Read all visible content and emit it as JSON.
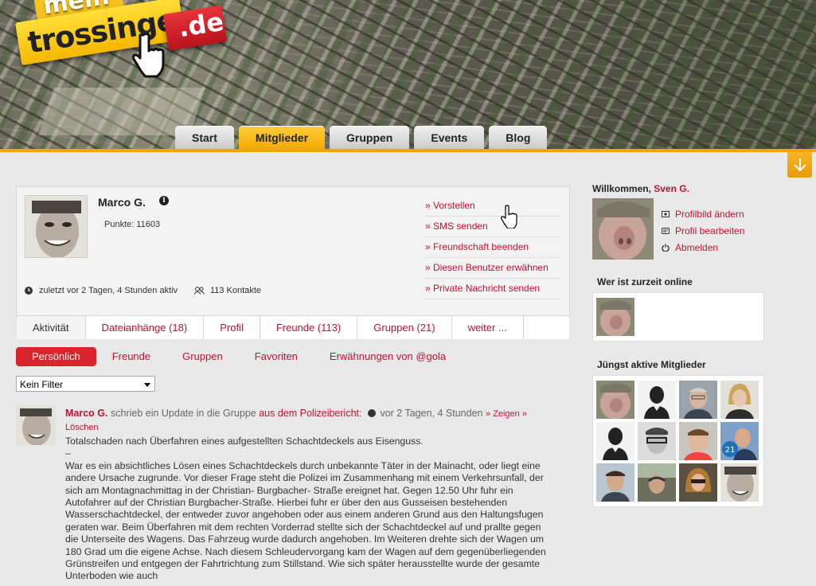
{
  "logo": {
    "line1": "mein",
    "line2": "trossingen",
    "tld": ".de"
  },
  "nav": {
    "tabs": [
      {
        "label": "Start",
        "active": false
      },
      {
        "label": "Mitglieder",
        "active": true
      },
      {
        "label": "Gruppen",
        "active": false
      },
      {
        "label": "Events",
        "active": false
      },
      {
        "label": "Blog",
        "active": false
      }
    ]
  },
  "profile": {
    "name": "Marco G.",
    "points": "Punkte: 11603",
    "last_active": "zuletzt vor 2 Tagen, 4 Stunden aktiv",
    "contacts": "113 Kontakte",
    "actions": [
      "» Vorstellen",
      "» SMS senden",
      "» Freundschaft beenden",
      "» Diesen Benutzer erwähnen",
      "» Private Nachricht senden"
    ],
    "tabs": [
      {
        "label": "Aktivität",
        "active": true
      },
      {
        "label": "Dateianhänge (18)",
        "active": false
      },
      {
        "label": "Profil",
        "active": false
      },
      {
        "label": "Freunde (113)",
        "active": false
      },
      {
        "label": "Gruppen (21)",
        "active": false
      },
      {
        "label": "weiter ...",
        "active": false
      }
    ]
  },
  "subnav": [
    {
      "label": "Persönlich",
      "active": true
    },
    {
      "label": "Freunde",
      "active": false
    },
    {
      "label": "Gruppen",
      "active": false
    },
    {
      "label": "Favoriten",
      "active": false
    },
    {
      "label": "Erwähnungen von @gola",
      "active": false
    }
  ],
  "filter": {
    "selected": "Kein Filter"
  },
  "activity": {
    "author": "Marco G.",
    "verb": "schrieb ein Update in die Gruppe",
    "group": "aus dem Polizeibericht",
    "time": "vor 2 Tagen, 4 Stunden",
    "show_link": "» Zeigen »",
    "delete_link": "Löschen",
    "title": "Totalschaden nach Überfahren eines aufgestellten Schachtdeckels aus Eisenguss.",
    "dash": "–",
    "body": "War es ein absichtliches Lösen eines Schachtdeckels durch unbekannte Täter in der Mainacht, oder liegt eine andere Ursache zugrunde. Vor dieser Frage steht die Polizei im Zusammenhang mit einem Verkehrsunfall, der sich am Montagnachmittag in der Christian- Burgbacher- Straße ereignet hat. Gegen 12.50 Uhr fuhr ein Autofahrer auf der Christian Burgbacher-Straße. Hierbei fuhr er über den aus Gusseisen bestehenden Wasserschachtdeckel, der entweder zuvor angehoben oder aus einem anderen Grund aus den Haltungsfugen geraten war. Beim Überfahren mit dem rechten Vorderrad stellte sich der Schachtdeckel auf und prallte gegen die Unterseite des Wagens. Das Fahrzeug wurde dadurch angehoben. Im Weiteren drehte sich der Wagen um 180 Grad um die eigene Achse. Nach diesem Schleudervorgang kam der Wagen auf dem gegenüberliegenden Grünstreifen und entgegen der Fahrtrichtung zum Stillstand. Wie sich später herausstellte wurde der gesamte Unterboden wie auch"
  },
  "sidebar": {
    "welcome": "Willkommen,",
    "user": "Sven G.",
    "links": [
      "Profilbild ändern",
      "Profil bearbeiten",
      "Abmelden"
    ],
    "online_title": "Wer ist zurzeit online",
    "recent_title": "Jüngst aktive Mitglieder"
  },
  "colors": {
    "accent": "#c8102e",
    "nav_active": "#f4a900",
    "pill_active": "#d9242b"
  }
}
